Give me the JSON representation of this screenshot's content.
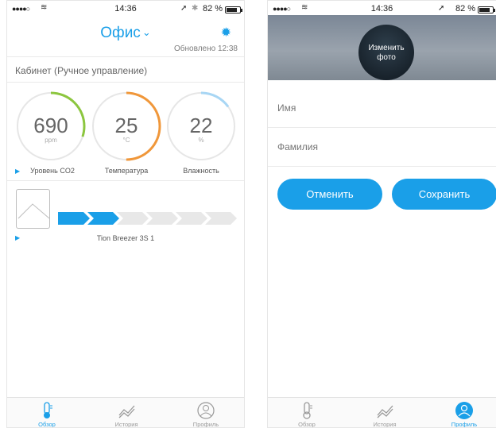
{
  "left": {
    "status": {
      "signal": "●●●●○",
      "time": "14:36",
      "battery": "82 %",
      "battery_level": 0.82
    },
    "header": {
      "location": "Офис",
      "updated": "Обновлено 12:38"
    },
    "room": "Кабинет (Ручное управление)",
    "gauges": [
      {
        "value": "690",
        "unit": "ppm",
        "label": "Уровень CO2",
        "level": 0.3,
        "color": "#8cc63f"
      },
      {
        "value": "25",
        "unit": "°C",
        "label": "Температура",
        "level": 0.5,
        "color": "#f0973a"
      },
      {
        "value": "22",
        "unit": "%",
        "label": "Влажность",
        "level": 0.15,
        "color": "#a8d6f4"
      }
    ],
    "device": {
      "name": "Tion Breezer 3S 1",
      "speed": 2,
      "speed_max": 6
    },
    "tabs": [
      {
        "label": "Обзор",
        "icon": "thermometer-icon",
        "active": true
      },
      {
        "label": "История",
        "icon": "chart-line-icon",
        "active": false
      },
      {
        "label": "Профиль",
        "icon": "profile-icon",
        "active": false
      }
    ]
  },
  "right": {
    "status": {
      "signal": "●●●●○",
      "time": "14:36",
      "battery": "82 %",
      "battery_level": 0.82
    },
    "photo_label": "Изменить фото",
    "first_name_placeholder": "Имя",
    "last_name_placeholder": "Фамилия",
    "cancel_label": "Отменить",
    "save_label": "Сохранить",
    "tabs": [
      {
        "label": "Обзор",
        "icon": "thermometer-icon",
        "active": false
      },
      {
        "label": "История",
        "icon": "chart-line-icon",
        "active": false
      },
      {
        "label": "Профиль",
        "icon": "profile-icon",
        "active": true
      }
    ]
  },
  "colors": {
    "accent": "#1a9fe8",
    "inactive_segment": "#e8e8e8"
  }
}
